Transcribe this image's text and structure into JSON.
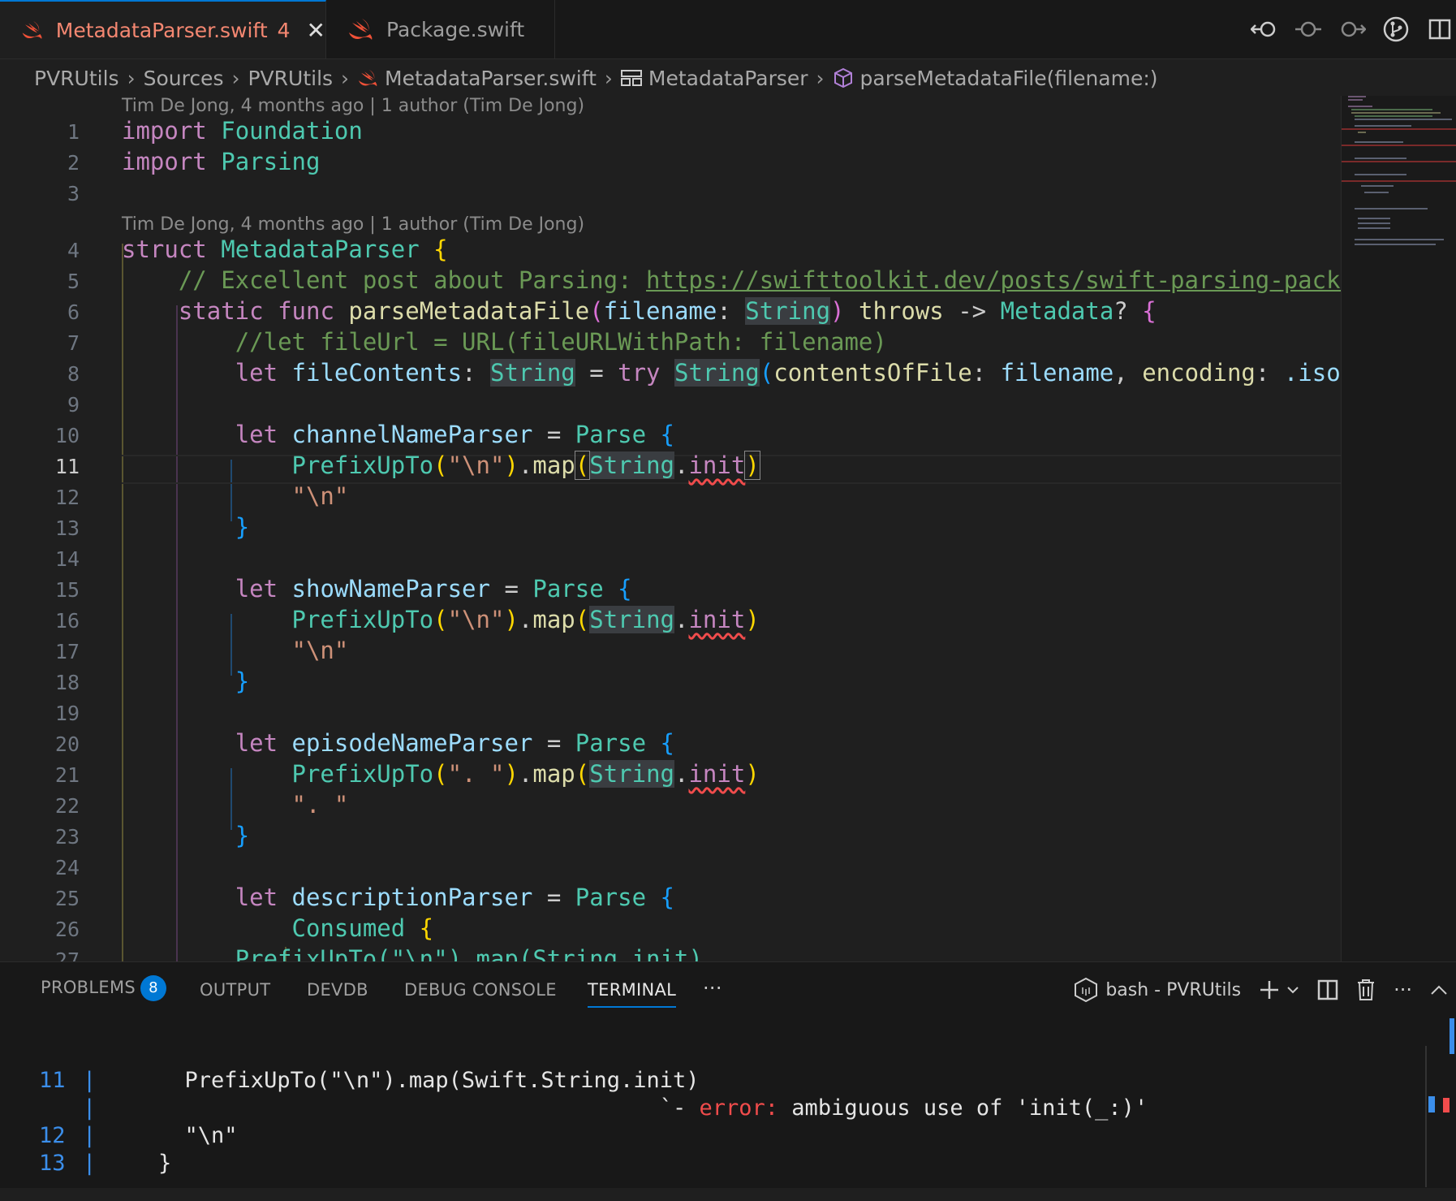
{
  "tabs": [
    {
      "label": "MetadataParser.swift",
      "count": "4",
      "active": true
    },
    {
      "label": "Package.swift",
      "count": "",
      "active": false
    }
  ],
  "toolbar_icons": [
    "go-back-icon",
    "timeline-icon",
    "go-forward-icon",
    "source-control-icon",
    "split-editor-icon"
  ],
  "breadcrumb": {
    "items": [
      "PVRUtils",
      "Sources",
      "PVRUtils",
      "MetadataParser.swift",
      "MetadataParser",
      "parseMetadataFile(filename:)"
    ]
  },
  "blame": {
    "line1": "Tim De Jong, 4 months ago | 1 author (Tim De Jong)",
    "line4": "Tim De Jong, 4 months ago | 1 author (Tim De Jong)"
  },
  "editor": {
    "current_line": "11",
    "line_numbers": [
      "1",
      "2",
      "3",
      "4",
      "5",
      "6",
      "7",
      "8",
      "9",
      "10",
      "11",
      "12",
      "13",
      "14",
      "15",
      "16",
      "17",
      "18",
      "19",
      "20",
      "21",
      "22",
      "23",
      "24",
      "25",
      "26",
      "27"
    ],
    "tokens": {
      "import": "import",
      "foundation": "Foundation",
      "parsing": "Parsing",
      "struct": "struct",
      "metadataParser": "MetadataParser",
      "comment5": "// Excellent post about Parsing: ",
      "url": "https://swifttoolkit.dev/posts/swift-parsing-package",
      "static": "static",
      "func": "func",
      "parseMetadataFile": "parseMetadataFile",
      "filename": "filename",
      "String": "String",
      "throws": "throws",
      "arrow": "->",
      "Metadata": "Metadata",
      "q": "?",
      "comment7": "//let fileUrl = URL(fileURLWithPath: filename)",
      "let": "let",
      "fileContents": "fileContents",
      "try": "try",
      "contentsOfFile": "contentsOfFile",
      "encoding": "encoding",
      "isoLat": ".isoLat",
      "channelNameParser": "channelNameParser",
      "showNameParser": "showNameParser",
      "episodeNameParser": "episodeNameParser",
      "descriptionParser": "descriptionParser",
      "Parse": "Parse",
      "PrefixUpTo": "PrefixUpTo",
      "map": "map",
      "init": "init",
      "nl": "\"\\n\"",
      "dot": "\". \"",
      "Consumed": "Consumed",
      "line27": "        PrefixUpTo(\"\\n\").map(String.init)"
    }
  },
  "panel": {
    "tabs": [
      "PROBLEMS",
      "OUTPUT",
      "DEVDB",
      "DEBUG CONSOLE",
      "TERMINAL"
    ],
    "problems_count": "8",
    "active_tab": "TERMINAL",
    "more": "···",
    "terminal_name": "bash - PVRUtils"
  },
  "terminal": {
    "lines": [
      {
        "num": "11",
        "bar": "|",
        "text": "      PrefixUpTo(\"\\n\").map(Swift.String.init)"
      },
      {
        "num": "",
        "bar": "|",
        "text": "                                          `- ",
        "err": "error:",
        "msg": " ambiguous use of 'init(_:)'"
      },
      {
        "num": "12",
        "bar": "|",
        "text": "      \"\\n\""
      },
      {
        "num": "13",
        "bar": "|",
        "text": "    }"
      }
    ]
  },
  "colors": {
    "accent": "#0078d4",
    "error": "#f14c4c",
    "swift_orange": "#f05138",
    "modified_tab": "#f48771"
  }
}
